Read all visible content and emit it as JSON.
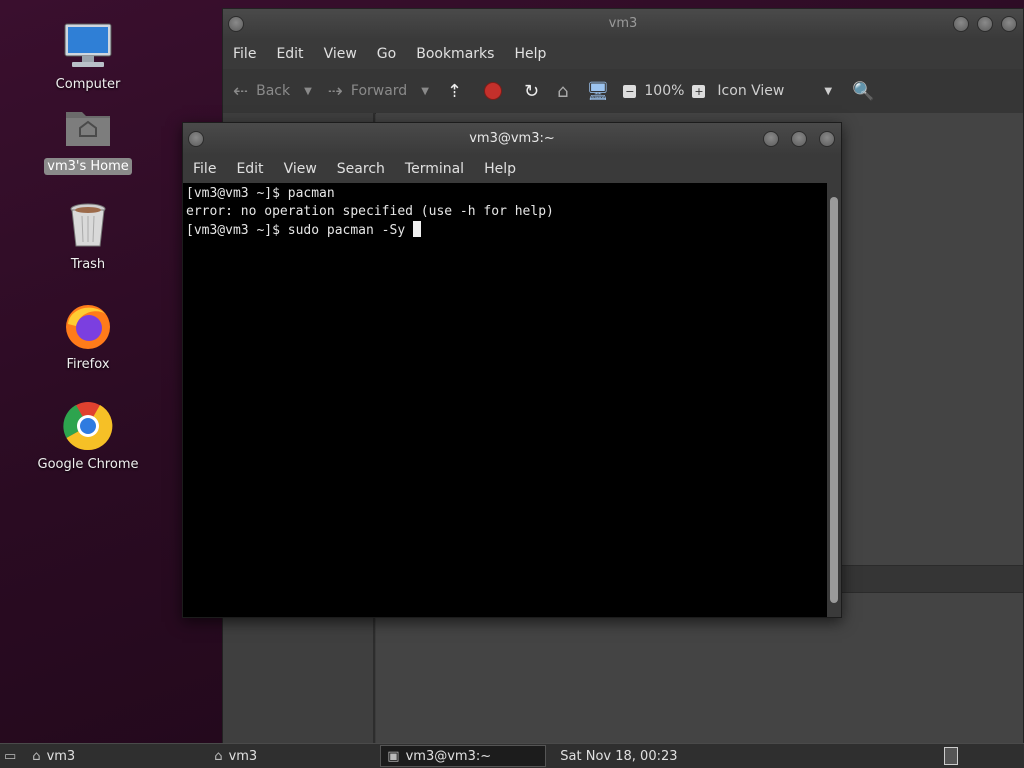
{
  "desktop": {
    "icons": [
      {
        "label": "Computer",
        "icon": "computer-icon"
      },
      {
        "label": "vm3's Home",
        "icon": "home-folder-icon"
      },
      {
        "label": "Trash",
        "icon": "trash-icon"
      },
      {
        "label": "Firefox",
        "icon": "firefox-icon"
      },
      {
        "label": "Google Chrome",
        "icon": "chrome-icon"
      }
    ]
  },
  "file_manager": {
    "title": "vm3",
    "menu": [
      "File",
      "Edit",
      "View",
      "Go",
      "Bookmarks",
      "Help"
    ],
    "toolbar": {
      "back": "Back",
      "forward": "Forward",
      "zoom": "100%",
      "view_mode": "Icon View"
    }
  },
  "terminal": {
    "title": "vm3@vm3:~",
    "menu": [
      "File",
      "Edit",
      "View",
      "Search",
      "Terminal",
      "Help"
    ],
    "lines": [
      "[vm3@vm3 ~]$ pacman",
      "error: no operation specified (use -h for help)",
      "[vm3@vm3 ~]$ sudo pacman -Sy "
    ]
  },
  "taskbar": {
    "tasks": [
      {
        "label": "vm3",
        "icon": "home-folder-icon"
      },
      {
        "label": "vm3",
        "icon": "home-folder-icon"
      },
      {
        "label": "vm3@vm3:~",
        "icon": "terminal-icon"
      }
    ],
    "clock": "Sat Nov 18, 00:23"
  },
  "colors": {
    "desktop_bg": "#2a0b22",
    "window_bg": "#3c3c3c",
    "terminal_bg": "#000000"
  }
}
